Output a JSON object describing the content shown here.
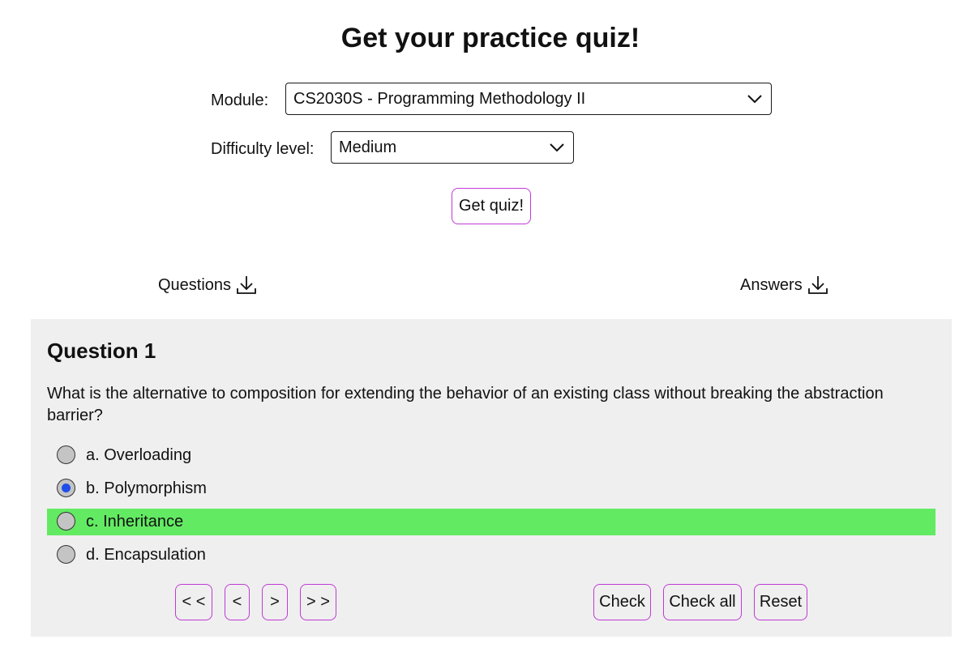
{
  "page": {
    "title": "Get your practice quiz!"
  },
  "form": {
    "module_label": "Module:",
    "module_value": "CS2030S - Programming Methodology II",
    "difficulty_label": "Difficulty level:",
    "difficulty_value": "Medium",
    "get_quiz_label": "Get quiz!"
  },
  "downloads": {
    "questions_label": "Questions",
    "answers_label": "Answers",
    "icon": "download-icon"
  },
  "question": {
    "title": "Question 1",
    "text": "What is the alternative to composition for extending the behavior of an existing class without breaking the abstraction barrier?",
    "options": [
      {
        "label": "a. Overloading",
        "selected": false,
        "correct": false
      },
      {
        "label": "b. Polymorphism",
        "selected": true,
        "correct": false
      },
      {
        "label": "c. Inheritance",
        "selected": false,
        "correct": true
      },
      {
        "label": "d. Encapsulation",
        "selected": false,
        "correct": false
      }
    ]
  },
  "navigation": {
    "first_label": "< <",
    "prev_label": "<",
    "next_label": ">",
    "last_label": "> >"
  },
  "actions": {
    "check_label": "Check",
    "check_all_label": "Check all",
    "reset_label": "Reset"
  },
  "colors": {
    "button_border": "#c03ad6",
    "correct_highlight": "#63ea63",
    "selected_radio": "#1f4fe8",
    "panel_background": "#efefef"
  }
}
